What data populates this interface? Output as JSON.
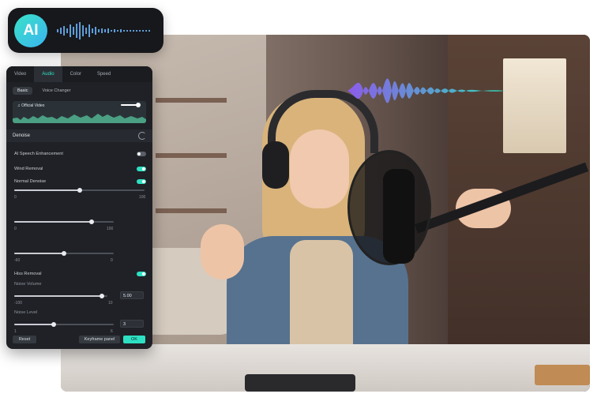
{
  "ai_badge": {
    "label": "AI"
  },
  "panel": {
    "tabs": [
      {
        "label": "Video",
        "active": false
      },
      {
        "label": "Audio",
        "active": true
      },
      {
        "label": "Color",
        "active": false
      },
      {
        "label": "Speed",
        "active": false
      }
    ],
    "subtabs": [
      {
        "label": "Basic",
        "active": true
      },
      {
        "label": "Voice Changer",
        "active": false
      }
    ],
    "clip": {
      "label": "Official Video",
      "volume_level": 0.85
    },
    "denoise": {
      "label": "Denoise"
    },
    "ai_speech_enhancement": {
      "label": "AI Speech Enhancement",
      "enabled": false
    },
    "wind_removal": {
      "label": "Wind Removal",
      "enabled": true
    },
    "normal_denoise": {
      "label": "Normal Denoise",
      "enabled": true,
      "slider_min": "0",
      "slider_max": "100",
      "value": 50
    },
    "slider2": {
      "min": "0",
      "max": "100",
      "value": 78
    },
    "slider3": {
      "min": "-60",
      "max": "0",
      "value": 50
    },
    "hiss_removal": {
      "label": "Hiss Removal",
      "enabled": true
    },
    "noise_volume": {
      "label": "Noise Volume",
      "min": "-100",
      "max": "10",
      "value": "5.00",
      "level": 0.94
    },
    "noise_level": {
      "label": "Noise Level",
      "min": "1",
      "max": "6",
      "value": "3",
      "level": 0.4
    },
    "buttons": {
      "reset": "Reset",
      "keyframe": "Keyframe panel",
      "ok": "OK"
    }
  },
  "colors": {
    "accent": "#2ee0c3",
    "panel_bg": "#1f2126",
    "wave_start": "#8e5cf0",
    "wave_end": "#2ee0c3"
  },
  "icons": {
    "reset": "reset-icon",
    "music": "music-note-icon"
  }
}
